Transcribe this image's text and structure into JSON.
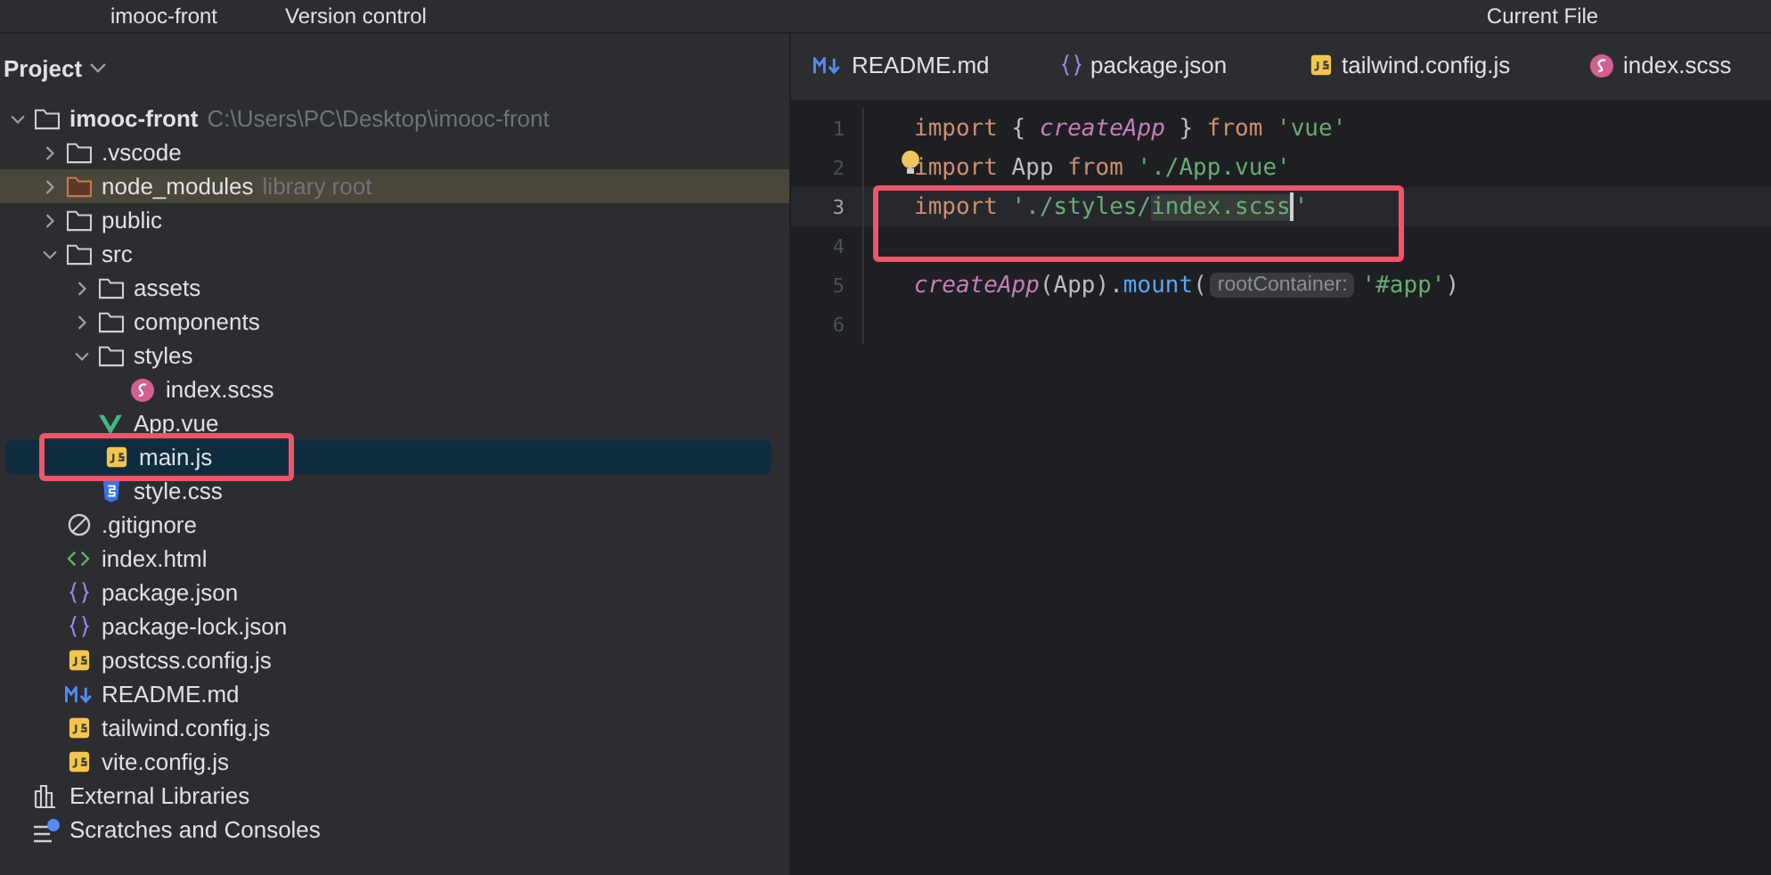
{
  "top_bar": {
    "project": "imooc-front",
    "vcs": "Version control",
    "run_config": "Current File"
  },
  "sidebar": {
    "title": "Project",
    "tree": [
      {
        "name": "imooc-front",
        "kind": "folder",
        "bold": true,
        "hint": "C:\\Users\\PC\\Desktop\\imooc-front",
        "expanded": true,
        "selected": false,
        "highlighted": false,
        "excluded": false,
        "children": [
          {
            "name": ".vscode",
            "kind": "folder",
            "expanded": false,
            "selected": false,
            "highlighted": false,
            "excluded": false
          },
          {
            "name": "node_modules",
            "kind": "folder",
            "hint": "library root",
            "expanded": false,
            "selected": false,
            "highlighted": false,
            "excluded": true
          },
          {
            "name": "public",
            "kind": "folder",
            "expanded": false,
            "selected": false,
            "highlighted": false,
            "excluded": false
          },
          {
            "name": "src",
            "kind": "folder",
            "expanded": true,
            "selected": false,
            "highlighted": false,
            "excluded": false,
            "children": [
              {
                "name": "assets",
                "kind": "folder",
                "expanded": false,
                "selected": false,
                "highlighted": false,
                "excluded": false
              },
              {
                "name": "components",
                "kind": "folder",
                "expanded": false,
                "selected": false,
                "highlighted": false,
                "excluded": false
              },
              {
                "name": "styles",
                "kind": "folder",
                "expanded": true,
                "selected": false,
                "highlighted": false,
                "excluded": false,
                "children": [
                  {
                    "name": "index.scss",
                    "kind": "scss",
                    "selected": false,
                    "highlighted": false,
                    "excluded": false
                  }
                ]
              },
              {
                "name": "App.vue",
                "kind": "vue",
                "selected": false,
                "highlighted": false,
                "excluded": false
              },
              {
                "name": "main.js",
                "kind": "js",
                "selected": true,
                "highlighted": true,
                "excluded": false
              },
              {
                "name": "style.css",
                "kind": "css",
                "selected": false,
                "highlighted": false,
                "excluded": false
              }
            ]
          },
          {
            "name": ".gitignore",
            "kind": "ignore",
            "selected": false,
            "highlighted": false,
            "excluded": false
          },
          {
            "name": "index.html",
            "kind": "html",
            "selected": false,
            "highlighted": false,
            "excluded": false
          },
          {
            "name": "package.json",
            "kind": "json",
            "selected": false,
            "highlighted": false,
            "excluded": false
          },
          {
            "name": "package-lock.json",
            "kind": "json",
            "selected": false,
            "highlighted": false,
            "excluded": false
          },
          {
            "name": "postcss.config.js",
            "kind": "js",
            "selected": false,
            "highlighted": false,
            "excluded": false
          },
          {
            "name": "README.md",
            "kind": "md",
            "selected": false,
            "highlighted": false,
            "excluded": false
          },
          {
            "name": "tailwind.config.js",
            "kind": "js",
            "selected": false,
            "highlighted": false,
            "excluded": false
          },
          {
            "name": "vite.config.js",
            "kind": "js",
            "selected": false,
            "highlighted": false,
            "excluded": false
          }
        ]
      },
      {
        "name": "External Libraries",
        "kind": "libraries",
        "selected": false,
        "highlighted": false,
        "excluded": false
      },
      {
        "name": "Scratches and Consoles",
        "kind": "scratches",
        "selected": false,
        "highlighted": false,
        "excluded": false
      }
    ]
  },
  "editor": {
    "tabs": [
      {
        "label": "README.md",
        "kind": "md",
        "selected": false
      },
      {
        "label": "package.json",
        "kind": "json",
        "selected": false
      },
      {
        "label": "tailwind.config.js",
        "kind": "js",
        "selected": false
      },
      {
        "label": "index.scss",
        "kind": "scss",
        "selected": false
      }
    ],
    "lines": [
      {
        "number": "1",
        "current": false,
        "highlighted": false,
        "bulb": false,
        "tokens": [
          {
            "kind": "keyword",
            "text": "import"
          },
          {
            "kind": "plain",
            "text": " { "
          },
          {
            "kind": "function",
            "text": "createApp"
          },
          {
            "kind": "plain",
            "text": " } "
          },
          {
            "kind": "keyword",
            "text": "from"
          },
          {
            "kind": "string",
            "text": " 'vue'"
          }
        ]
      },
      {
        "number": "2",
        "current": false,
        "highlighted": false,
        "bulb": true,
        "tokens": [
          {
            "kind": "keyword",
            "text": "import"
          },
          {
            "kind": "plain",
            "text": " App "
          },
          {
            "kind": "keyword",
            "text": "from"
          },
          {
            "kind": "string",
            "text": " './App.vue'"
          }
        ]
      },
      {
        "number": "3",
        "current": true,
        "highlighted": true,
        "bulb": false,
        "tokens": [
          {
            "kind": "keyword",
            "text": "import"
          },
          {
            "kind": "string",
            "text": " './styles/"
          },
          {
            "kind": "string-match",
            "text": "index.scss"
          },
          {
            "kind": "caret"
          },
          {
            "kind": "string",
            "text": "'"
          }
        ]
      },
      {
        "number": "4",
        "current": false,
        "highlighted": false,
        "bulb": false
      },
      {
        "number": "5",
        "current": false,
        "highlighted": false,
        "bulb": false,
        "tokens": [
          {
            "kind": "function",
            "text": "createApp"
          },
          {
            "kind": "plain",
            "text": "(App)."
          },
          {
            "kind": "method",
            "text": "mount"
          },
          {
            "kind": "plain",
            "text": "("
          },
          {
            "kind": "hint",
            "text": "rootContainer:"
          },
          {
            "kind": "string",
            "text": "'#app'"
          },
          {
            "kind": "plain",
            "text": ")"
          }
        ]
      },
      {
        "number": "6",
        "current": false,
        "highlighted": false,
        "bulb": false
      }
    ]
  }
}
